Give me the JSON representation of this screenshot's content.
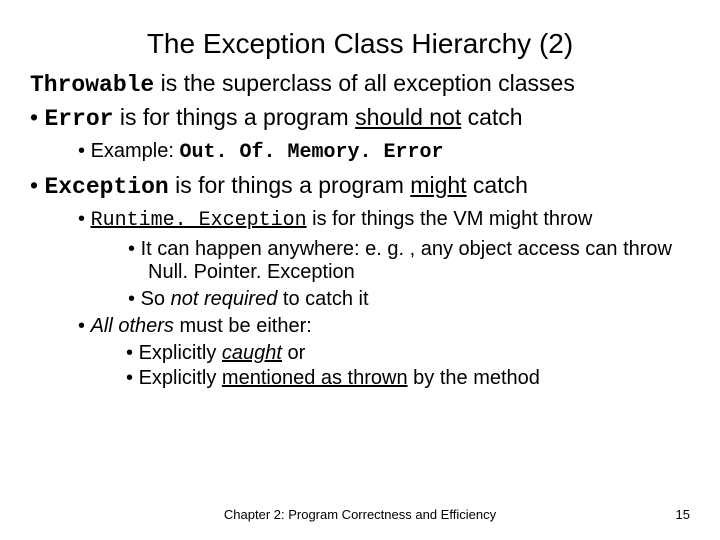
{
  "title": "The Exception Class Hierarchy (2)",
  "intro": {
    "code": "Throwable",
    "rest": " is the superclass of all exception classes"
  },
  "b1": {
    "code": "Error",
    "rest_a": " is for things a program ",
    "und": "should not",
    "rest_b": " catch",
    "example": {
      "label": "Example: ",
      "code": "Out. Of. Memory. Error"
    }
  },
  "b2": {
    "code": "Exception",
    "rest_a": " is for things a program ",
    "und": "might",
    "rest_b": " catch",
    "sub1": {
      "code": "Runtime. Exception",
      "rest": " is for things the VM might throw",
      "p1": "It can happen anywhere: e. g. , any object access can throw Null. Pointer. Exception",
      "p2_a": "So ",
      "p2_i": "not required",
      "p2_b": " to catch it"
    },
    "sub2": {
      "a": "All others",
      "b": " must be either:",
      "c1_a": "Explicitly ",
      "c1_u": "caught",
      "c1_b": " or",
      "c2_a": "Explicitly ",
      "c2_u": "mentioned as thrown",
      "c2_b": " by the method"
    }
  },
  "footer": "Chapter 2: Program Correctness and Efficiency",
  "page": "15"
}
